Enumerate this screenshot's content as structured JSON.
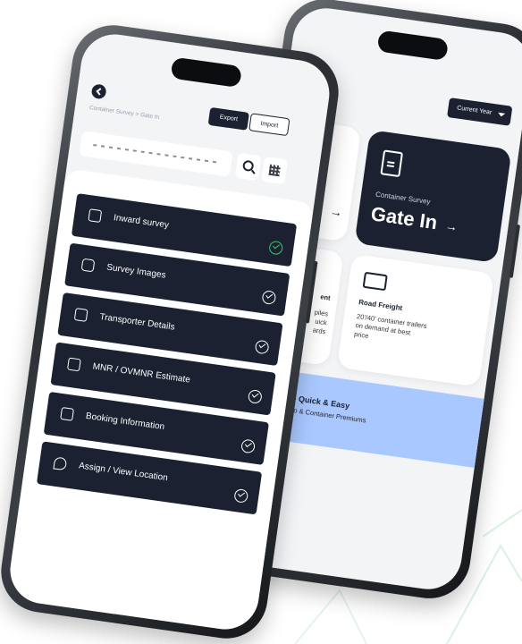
{
  "back_screen": {
    "year_select": "Current Year",
    "gate_in_card": {
      "subtitle": "Container Survey",
      "title": "Gate In",
      "arrow": "→"
    },
    "left_top_card": {
      "arrow": "→"
    },
    "road_freight_card": {
      "title": "Road Freight",
      "description": "20'/40' container trailers on demand at best price"
    },
    "left_mid_card": {
      "title": "ent",
      "line1": "piles",
      "line2": "uick",
      "line3": "ards"
    },
    "banner": {
      "title": "surance - Quick & Easy",
      "subtitle": "ing on Cargo & Container Premiums"
    }
  },
  "front_screen": {
    "breadcrumb": "Container Survey > Gate In",
    "tabs": {
      "export": "Export",
      "import": "Import"
    },
    "menu": [
      {
        "label": "Inward survey",
        "icon": "login-icon",
        "status": "done"
      },
      {
        "label": "Survey Images",
        "icon": "camera-icon",
        "status": "pending"
      },
      {
        "label": "Transporter Details",
        "icon": "truck-icon",
        "status": "pending"
      },
      {
        "label": "MNR / OVMNR Estimate",
        "icon": "estimate-icon",
        "status": "pending"
      },
      {
        "label": "Booking Information",
        "icon": "document-icon",
        "status": "pending"
      },
      {
        "label": "Assign / View Location",
        "icon": "location-pin-icon",
        "status": "pending"
      }
    ]
  },
  "colors": {
    "dark": "#1b2130",
    "accent_check": "#3ec96b",
    "banner": "#a9c8ff"
  }
}
